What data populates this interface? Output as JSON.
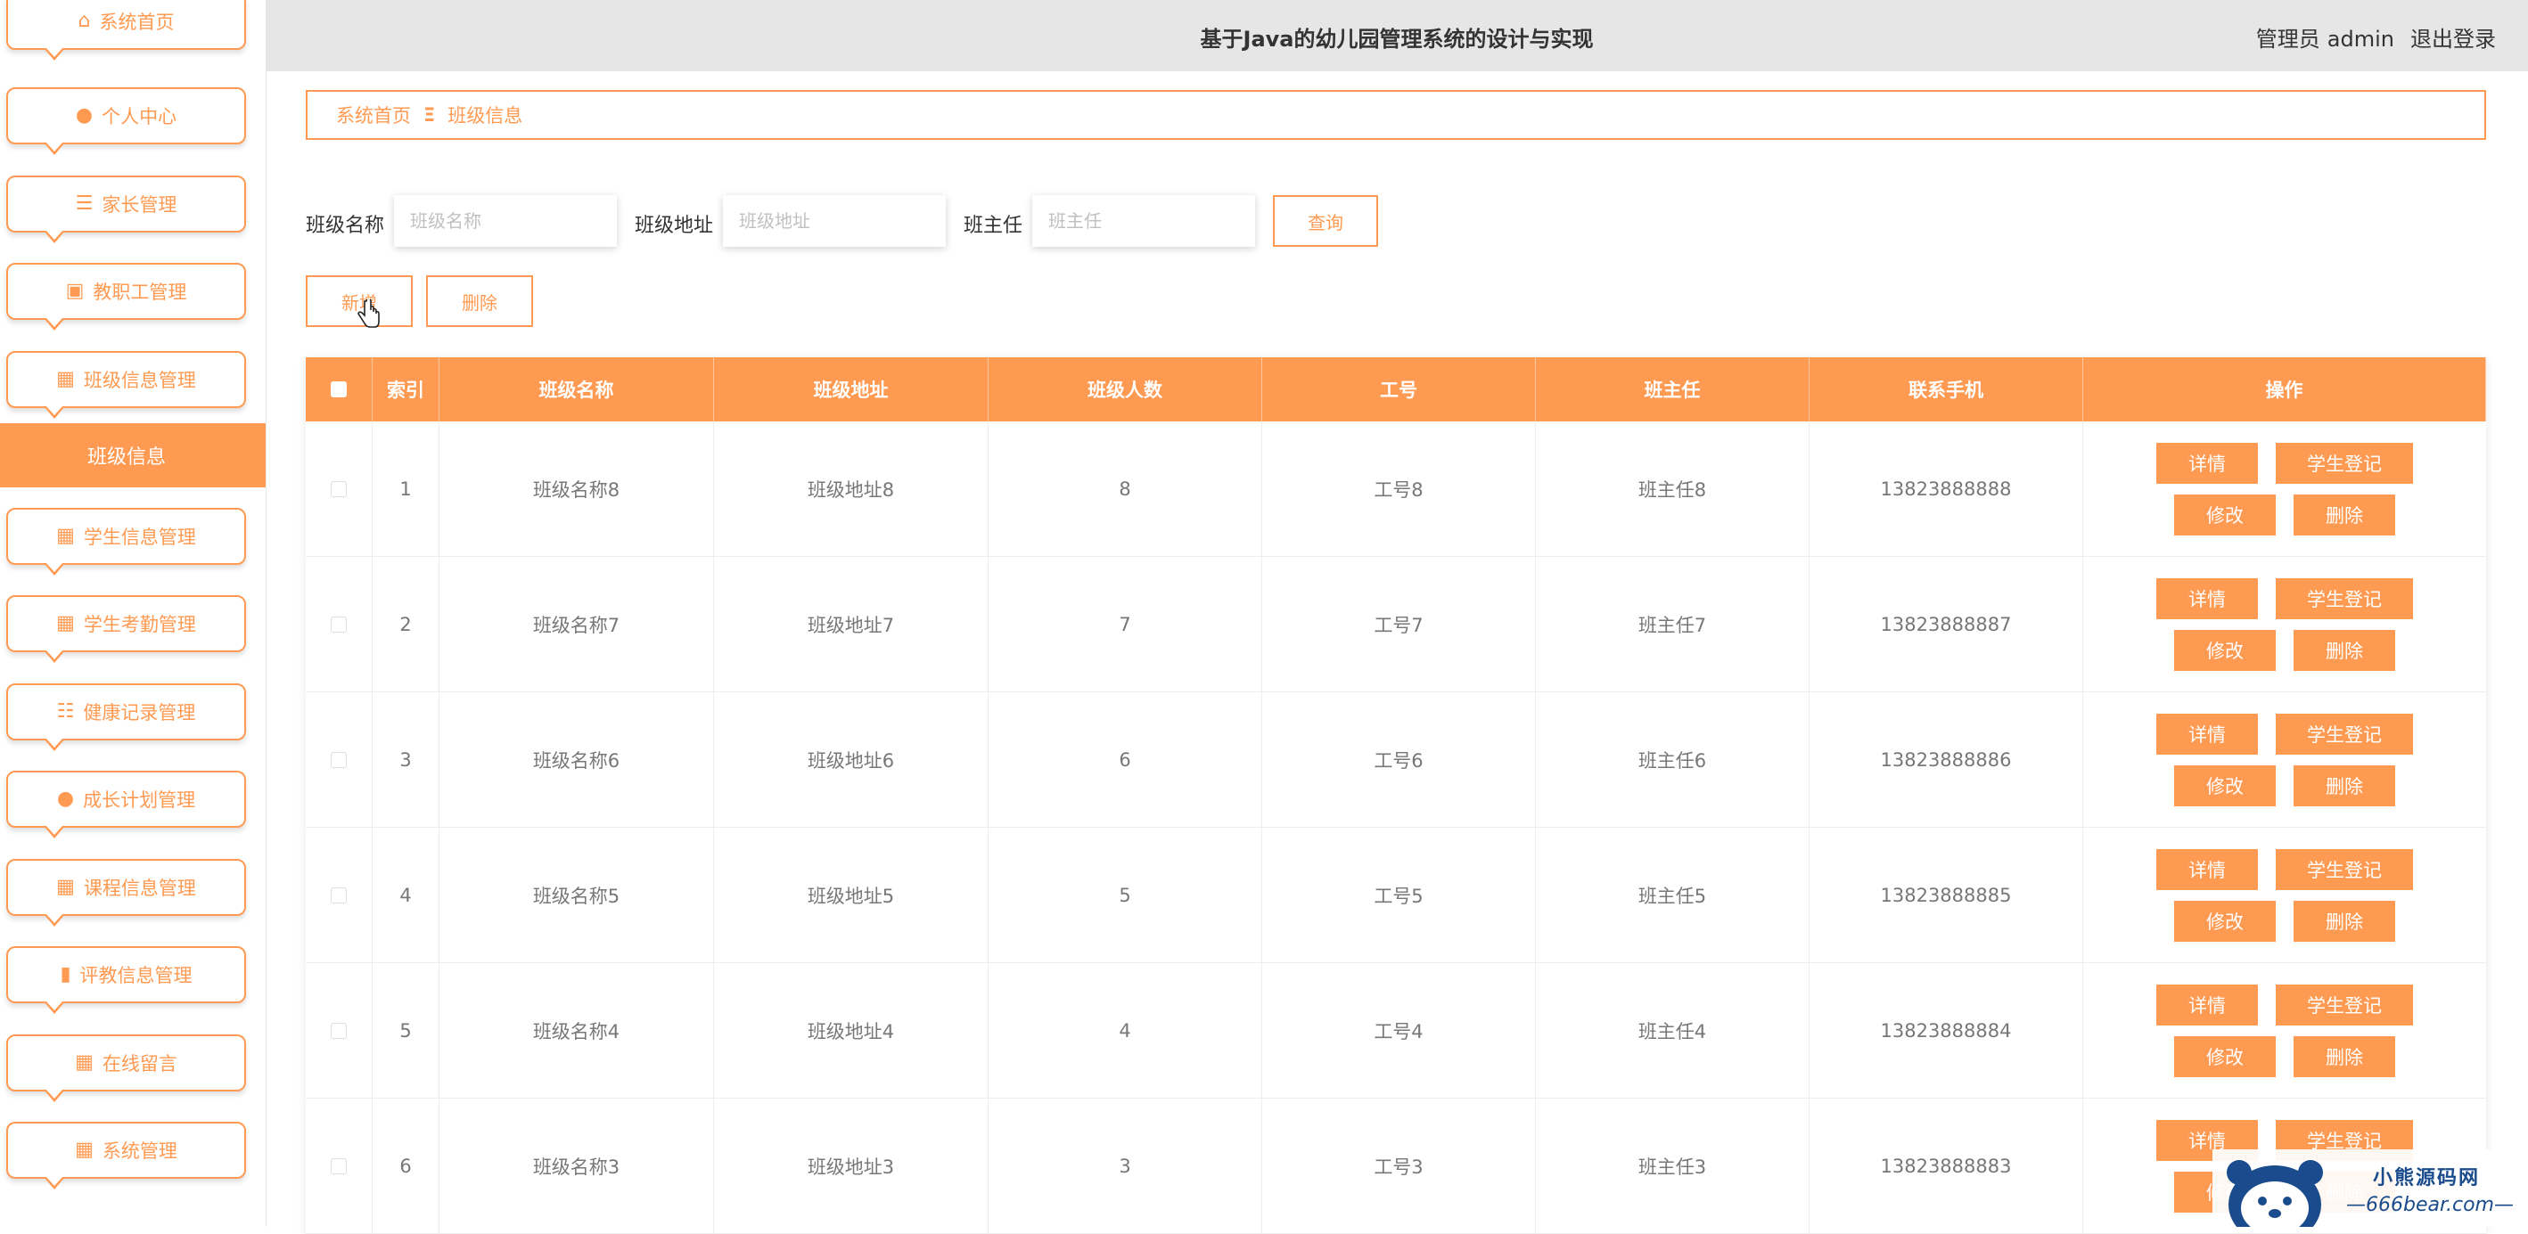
{
  "header": {
    "title": "基于Java的幼儿园管理系统的设计与实现",
    "role": "管理员",
    "username": "admin",
    "logout_label": "退出登录"
  },
  "sidebar": {
    "items": [
      {
        "label": "系统首页",
        "icon": "home-icon",
        "glyph": "⌂"
      },
      {
        "label": "个人中心",
        "icon": "user-icon",
        "glyph": "●"
      },
      {
        "label": "家长管理",
        "icon": "list-icon",
        "glyph": "☰"
      },
      {
        "label": "教职工管理",
        "icon": "briefcase-icon",
        "glyph": "▣"
      },
      {
        "label": "班级信息管理",
        "icon": "grid-icon",
        "glyph": "▦"
      },
      {
        "label": "学生信息管理",
        "icon": "grid-icon",
        "glyph": "▦"
      },
      {
        "label": "学生考勤管理",
        "icon": "grid-icon",
        "glyph": "▦"
      },
      {
        "label": "健康记录管理",
        "icon": "sliders-icon",
        "glyph": "☷"
      },
      {
        "label": "成长计划管理",
        "icon": "user-icon",
        "glyph": "●"
      },
      {
        "label": "课程信息管理",
        "icon": "grid-icon",
        "glyph": "▦"
      },
      {
        "label": "评教信息管理",
        "icon": "bar-chart-icon",
        "glyph": "▮"
      },
      {
        "label": "在线留言",
        "icon": "grid-icon",
        "glyph": "▦"
      },
      {
        "label": "系统管理",
        "icon": "grid-icon",
        "glyph": "▦"
      }
    ],
    "sub_item": "班级信息"
  },
  "breadcrumb": {
    "home": "系统首页",
    "separator": "Ξ",
    "current": "班级信息"
  },
  "search": {
    "name_label": "班级名称",
    "name_placeholder": "班级名称",
    "address_label": "班级地址",
    "address_placeholder": "班级地址",
    "teacher_label": "班主任",
    "teacher_placeholder": "班主任",
    "query_label": "查询"
  },
  "actions": {
    "add_label": "新增",
    "delete_label": "删除"
  },
  "table": {
    "headers": [
      "索引",
      "班级名称",
      "班级地址",
      "班级人数",
      "工号",
      "班主任",
      "联系手机",
      "操作"
    ],
    "op_labels": {
      "detail": "详情",
      "register": "学生登记",
      "edit": "修改",
      "delete": "删除"
    },
    "rows": [
      {
        "index": "1",
        "name": "班级名称8",
        "address": "班级地址8",
        "count": "8",
        "no": "工号8",
        "teacher": "班主任8",
        "phone": "13823888888"
      },
      {
        "index": "2",
        "name": "班级名称7",
        "address": "班级地址7",
        "count": "7",
        "no": "工号7",
        "teacher": "班主任7",
        "phone": "13823888887"
      },
      {
        "index": "3",
        "name": "班级名称6",
        "address": "班级地址6",
        "count": "6",
        "no": "工号6",
        "teacher": "班主任6",
        "phone": "13823888886"
      },
      {
        "index": "4",
        "name": "班级名称5",
        "address": "班级地址5",
        "count": "5",
        "no": "工号5",
        "teacher": "班主任5",
        "phone": "13823888885"
      },
      {
        "index": "5",
        "name": "班级名称4",
        "address": "班级地址4",
        "count": "4",
        "no": "工号4",
        "teacher": "班主任4",
        "phone": "13823888884"
      },
      {
        "index": "6",
        "name": "班级名称3",
        "address": "班级地址3",
        "count": "3",
        "no": "工号3",
        "teacher": "班主任3",
        "phone": "13823888883"
      }
    ]
  },
  "watermark": {
    "line1": "小熊源码网",
    "line2": "—666bear.com—"
  },
  "colors": {
    "accent": "#ff9a52",
    "header_bg": "#e6e6e6"
  }
}
